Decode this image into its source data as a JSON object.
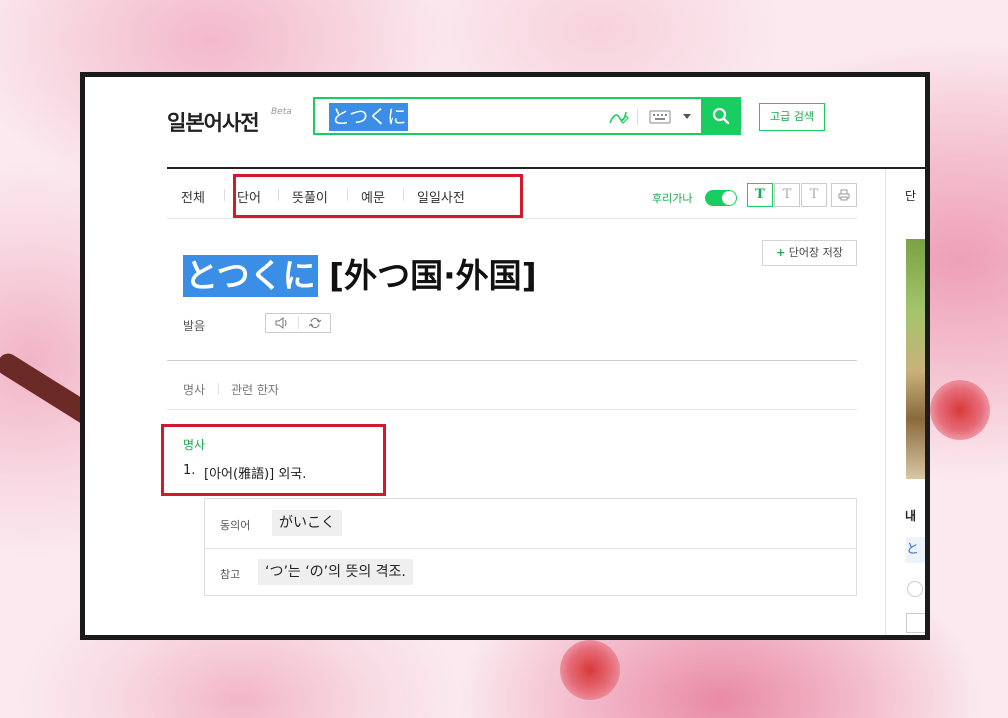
{
  "header": {
    "logo": "일본어사전",
    "logo_badge": "Beta",
    "search_value": "とつくに",
    "advanced_search": "고급 검색"
  },
  "tabs": [
    {
      "label": "전체"
    },
    {
      "label": "단어"
    },
    {
      "label": "뜻풀이"
    },
    {
      "label": "예문"
    },
    {
      "label": "일일사전"
    }
  ],
  "view_options": {
    "furigana_label": "후리가나",
    "furigana_on": true,
    "font_sizes": [
      "T",
      "T",
      "T"
    ]
  },
  "entry": {
    "save_button": "단어장 저장",
    "save_plus": "+",
    "headword": "とつくに",
    "kanji": "[外つ国·外国]",
    "pronunciation_label": "발음"
  },
  "subnav": {
    "items": [
      "명사",
      "관련 한자"
    ]
  },
  "definition": {
    "pos": "명사",
    "number": "1.",
    "text": "[아어(雅語)] 외국."
  },
  "related": {
    "synonym_label": "동의어",
    "synonym_value": "がいこく",
    "reference_label": "참고",
    "reference_value": "‘つ’는 ‘の’의 뜻의 격조."
  },
  "right_panel": {
    "top_label": "단",
    "mid_label": "내",
    "chip_text": "と"
  },
  "colors": {
    "brand_green": "#19ce60",
    "highlight_blue": "#3b8ee6",
    "annotation_red": "#d11b2c"
  }
}
